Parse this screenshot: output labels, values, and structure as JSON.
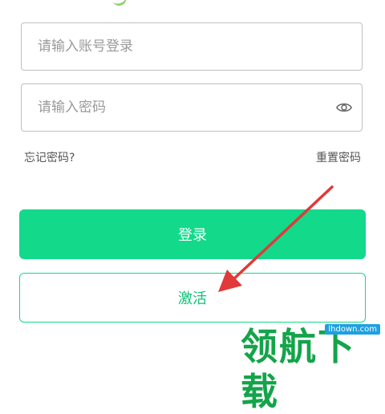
{
  "form": {
    "account_placeholder": "请输入账号登录",
    "password_placeholder": "请输入密码",
    "show_password_icon": "eye-icon"
  },
  "links": {
    "forgot_password": "忘记密码?",
    "reset_password": "重置密码"
  },
  "buttons": {
    "login": "登录",
    "activate": "激活"
  },
  "watermark": {
    "text": "领航下载",
    "url": "lhdown.com"
  },
  "colors": {
    "accent": "#13d98a",
    "annotation_arrow": "#e03a3a",
    "watermark": "#14a44a"
  }
}
